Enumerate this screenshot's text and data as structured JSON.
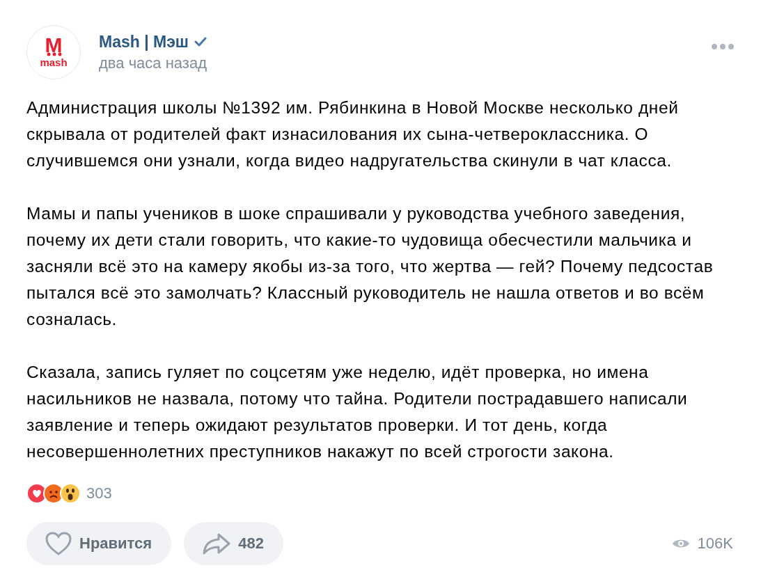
{
  "post": {
    "author": {
      "avatar": {
        "letter": "M",
        "word": "mash"
      },
      "name": "Mash | Мэш",
      "verified": true
    },
    "time": "два часа назад",
    "paragraphs": [
      "Администрация школы №1392 им. Рябинкина в Новой Москве несколько дней скрывала от родителей факт изнасилования их сына-четвероклассника. О случившемся они узнали, когда видео надругательства скинули в чат класса.",
      "Мамы и папы учеников в шоке спрашивали у руководства учебного заведения, почему их дети стали говорить, что какие-то чудовища обесчестили мальчика и засняли всё это на камеру якобы из-за того, что жертва — гей? Почему педсостав пытался всё это замолчать? Классный руководитель не нашла ответов и во всём созналась.",
      "Сказала, запись гуляет по соцсетям уже неделю, идёт проверка, но имена насильников не назвала, потому что тайна. Родители пострадавшего написали заявление и теперь ожидают результатов проверки. И тот день, когда несовершеннолетних преступников накажут по всей строгости закона."
    ],
    "reactions": {
      "items": [
        {
          "kind": "heart"
        },
        {
          "kind": "angry"
        },
        {
          "kind": "shocked"
        }
      ],
      "count": "303"
    },
    "like": {
      "label": "Нравится",
      "liked": false
    },
    "share": {
      "count": "482"
    },
    "views": "106K"
  }
}
